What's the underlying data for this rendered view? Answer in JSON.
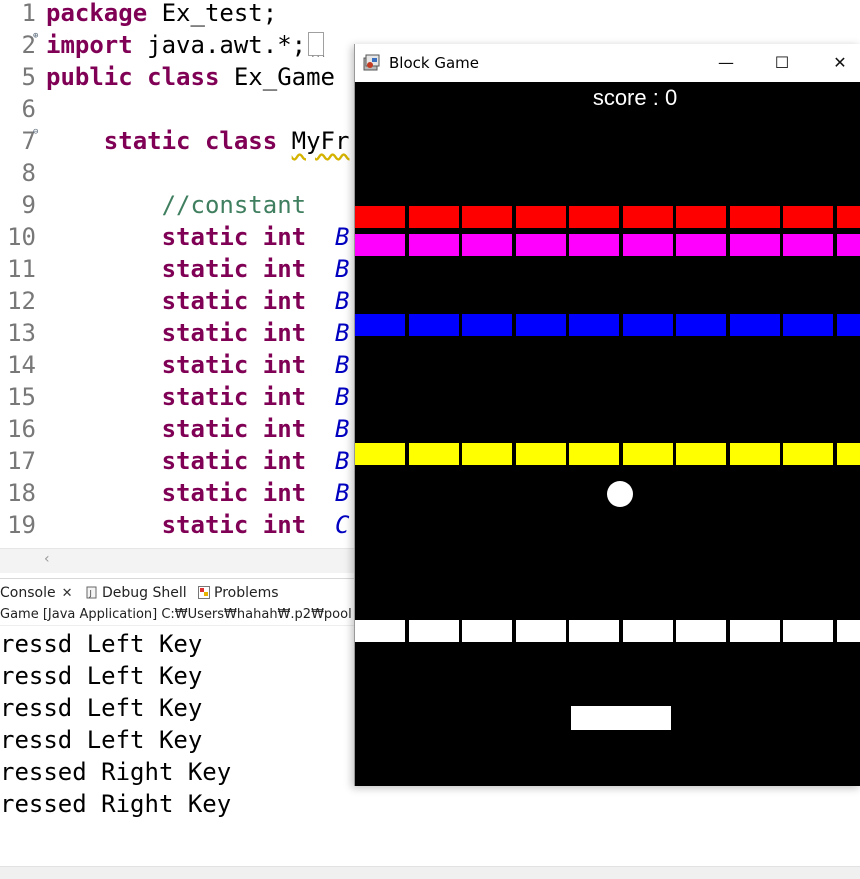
{
  "editor": {
    "lines": [
      {
        "num": "1",
        "segments": [
          {
            "t": "package",
            "c": "kw"
          },
          {
            "t": " Ex_test;",
            "c": ""
          }
        ]
      },
      {
        "num": "2",
        "fold": "⊕",
        "segments": [
          {
            "t": "import",
            "c": "kw"
          },
          {
            "t": " java.awt.*;",
            "c": ""
          }
        ],
        "collapsed": true
      },
      {
        "num": "5",
        "segments": [
          {
            "t": "public",
            "c": "kw"
          },
          {
            "t": " ",
            "c": ""
          },
          {
            "t": "class",
            "c": "kw"
          },
          {
            "t": " Ex_Game",
            "c": ""
          }
        ]
      },
      {
        "num": "6",
        "segments": []
      },
      {
        "num": "7",
        "fold": "⊖",
        "segments": [
          {
            "t": "    ",
            "c": ""
          },
          {
            "t": "static",
            "c": "kw"
          },
          {
            "t": " ",
            "c": ""
          },
          {
            "t": "class",
            "c": "kw"
          },
          {
            "t": " ",
            "c": ""
          },
          {
            "t": "MyFr",
            "c": "typ"
          }
        ]
      },
      {
        "num": "8",
        "segments": []
      },
      {
        "num": "9",
        "segments": [
          {
            "t": "        ",
            "c": ""
          },
          {
            "t": "//constant",
            "c": "cm"
          }
        ]
      },
      {
        "num": "10",
        "segments": [
          {
            "t": "        ",
            "c": ""
          },
          {
            "t": "static",
            "c": "kw"
          },
          {
            "t": " ",
            "c": ""
          },
          {
            "t": "int",
            "c": "kw"
          },
          {
            "t": "  ",
            "c": ""
          },
          {
            "t": "B",
            "c": "fld"
          }
        ]
      },
      {
        "num": "11",
        "segments": [
          {
            "t": "        ",
            "c": ""
          },
          {
            "t": "static",
            "c": "kw"
          },
          {
            "t": " ",
            "c": ""
          },
          {
            "t": "int",
            "c": "kw"
          },
          {
            "t": "  ",
            "c": ""
          },
          {
            "t": "B",
            "c": "fld"
          }
        ]
      },
      {
        "num": "12",
        "segments": [
          {
            "t": "        ",
            "c": ""
          },
          {
            "t": "static",
            "c": "kw"
          },
          {
            "t": " ",
            "c": ""
          },
          {
            "t": "int",
            "c": "kw"
          },
          {
            "t": "  ",
            "c": ""
          },
          {
            "t": "B",
            "c": "fld"
          }
        ]
      },
      {
        "num": "13",
        "segments": [
          {
            "t": "        ",
            "c": ""
          },
          {
            "t": "static",
            "c": "kw"
          },
          {
            "t": " ",
            "c": ""
          },
          {
            "t": "int",
            "c": "kw"
          },
          {
            "t": "  ",
            "c": ""
          },
          {
            "t": "B",
            "c": "fld"
          }
        ]
      },
      {
        "num": "14",
        "segments": [
          {
            "t": "        ",
            "c": ""
          },
          {
            "t": "static",
            "c": "kw"
          },
          {
            "t": " ",
            "c": ""
          },
          {
            "t": "int",
            "c": "kw"
          },
          {
            "t": "  ",
            "c": ""
          },
          {
            "t": "B",
            "c": "fld"
          }
        ]
      },
      {
        "num": "15",
        "segments": [
          {
            "t": "        ",
            "c": ""
          },
          {
            "t": "static",
            "c": "kw"
          },
          {
            "t": " ",
            "c": ""
          },
          {
            "t": "int",
            "c": "kw"
          },
          {
            "t": "  ",
            "c": ""
          },
          {
            "t": "B",
            "c": "fld"
          }
        ]
      },
      {
        "num": "16",
        "segments": [
          {
            "t": "        ",
            "c": ""
          },
          {
            "t": "static",
            "c": "kw"
          },
          {
            "t": " ",
            "c": ""
          },
          {
            "t": "int",
            "c": "kw"
          },
          {
            "t": "  ",
            "c": ""
          },
          {
            "t": "B",
            "c": "fld"
          }
        ]
      },
      {
        "num": "17",
        "segments": [
          {
            "t": "        ",
            "c": ""
          },
          {
            "t": "static",
            "c": "kw"
          },
          {
            "t": " ",
            "c": ""
          },
          {
            "t": "int",
            "c": "kw"
          },
          {
            "t": "  ",
            "c": ""
          },
          {
            "t": "B",
            "c": "fld"
          }
        ]
      },
      {
        "num": "18",
        "segments": [
          {
            "t": "        ",
            "c": ""
          },
          {
            "t": "static",
            "c": "kw"
          },
          {
            "t": " ",
            "c": ""
          },
          {
            "t": "int",
            "c": "kw"
          },
          {
            "t": "  ",
            "c": ""
          },
          {
            "t": "B",
            "c": "fld"
          }
        ]
      },
      {
        "num": "19",
        "segments": [
          {
            "t": "        ",
            "c": ""
          },
          {
            "t": "static",
            "c": "kw"
          },
          {
            "t": " ",
            "c": ""
          },
          {
            "t": "int",
            "c": "kw"
          },
          {
            "t": "  ",
            "c": ""
          },
          {
            "t": "C",
            "c": "fld"
          }
        ]
      }
    ]
  },
  "console": {
    "tabs": [
      {
        "label": "Console",
        "icon": "console-icon",
        "closable": true
      },
      {
        "label": "Debug Shell",
        "icon": "debug-shell-icon"
      },
      {
        "label": "Problems",
        "icon": "problems-icon"
      }
    ],
    "launch_path": "Game [Java Application] C:₩Users₩hahah₩.p2₩pool",
    "output": [
      "ressd Left Key",
      "ressd Left Key",
      "ressd Left Key",
      "ressd Left Key",
      "ressed Right Key",
      "ressed Right Key"
    ]
  },
  "game_window": {
    "title": "Block Game",
    "icon": "java-app-icon",
    "controls": {
      "minimize": "—",
      "maximize": "☐",
      "close": "✕"
    },
    "score_text": "score : 0",
    "colors": {
      "red": "#ff0000",
      "magenta": "#ff00ff",
      "blue": "#0000ff",
      "yellow": "#ffff00",
      "white": "#ffffff",
      "background": "#000000"
    },
    "brick_rows": [
      {
        "color": "red",
        "count": 10
      },
      {
        "color": "magenta",
        "count": 10
      },
      {
        "color": "blue",
        "count": 10
      },
      {
        "color": "yellow",
        "count": 10
      },
      {
        "color": "white",
        "count": 10
      }
    ]
  }
}
